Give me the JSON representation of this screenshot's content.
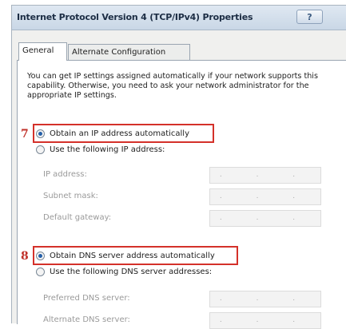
{
  "window": {
    "title": "Internet Protocol Version 4 (TCP/IPv4) Properties",
    "help_label": "?"
  },
  "tabs": [
    {
      "label": "General",
      "selected": true
    },
    {
      "label": "Alternate Configuration",
      "selected": false
    }
  ],
  "description": "You can get IP settings assigned automatically if your network supports this capability. Otherwise, you need to ask your network administrator for the appropriate IP settings.",
  "ip_section": {
    "step_number": "7",
    "auto_option": "Obtain an IP address automatically",
    "manual_option": "Use the following IP address:",
    "auto_selected": true,
    "fields": [
      {
        "label": "IP address:",
        "value": ". . ."
      },
      {
        "label": "Subnet mask:",
        "value": ". . ."
      },
      {
        "label": "Default gateway:",
        "value": ". . ."
      }
    ]
  },
  "dns_section": {
    "step_number": "8",
    "auto_option": "Obtain DNS server address automatically",
    "manual_option": "Use the following DNS server addresses:",
    "auto_selected": true,
    "fields": [
      {
        "label": "Preferred DNS server:",
        "value": ". . ."
      },
      {
        "label": "Alternate DNS server:",
        "value": ". . ."
      }
    ]
  },
  "colors": {
    "highlight": "#d4312a",
    "radio_dot": "#245fa8"
  }
}
